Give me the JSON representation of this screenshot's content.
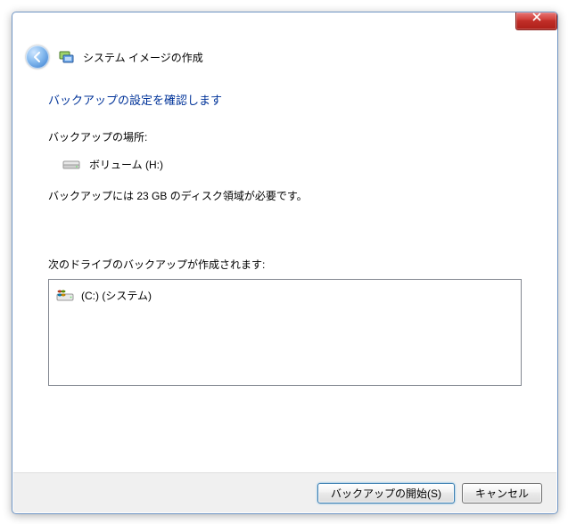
{
  "dialog": {
    "title": "システム イメージの作成",
    "subheading": "バックアップの設定を確認します",
    "location_label": "バックアップの場所:",
    "location_value": "ボリューム (H:)",
    "space_required": "バックアップには 23 GB のディスク領域が必要です。",
    "drives_list_label": "次のドライブのバックアップが作成されます:",
    "drives": [
      {
        "label": "(C:) (システム)"
      }
    ]
  },
  "buttons": {
    "start_backup": "バックアップの開始(S)",
    "cancel": "キャンセル"
  }
}
